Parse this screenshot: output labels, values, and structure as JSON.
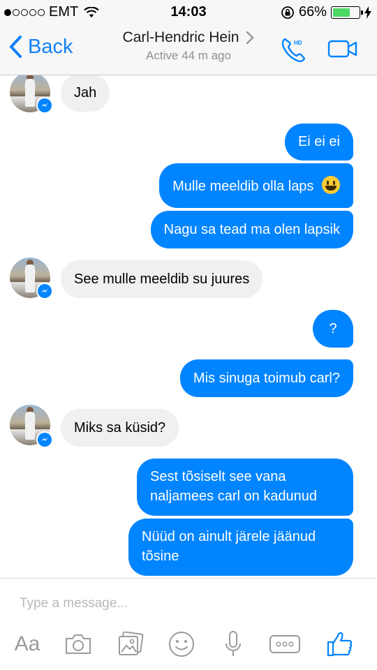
{
  "status_bar": {
    "carrier": "EMT",
    "time": "14:03",
    "battery_text": "66%",
    "battery_level": 0.66,
    "signal_bars_filled": 1,
    "signal_bars_total": 5
  },
  "nav": {
    "back_label": "Back",
    "contact_name": "Carl-Hendric Hein",
    "contact_status": "Active 44 m ago",
    "call_badge": "HD"
  },
  "messages": [
    {
      "direction": "in",
      "text": "Jah",
      "avatar": true
    },
    {
      "direction": "out",
      "text": "Ei ei ei"
    },
    {
      "direction": "out",
      "text": "Mulle meeldib olla laps",
      "emoji": "😃"
    },
    {
      "direction": "out",
      "text": "Nagu sa tead ma olen lapsik"
    },
    {
      "direction": "in",
      "text": "See mulle meeldib su juures",
      "avatar": true
    },
    {
      "direction": "out",
      "text": "?"
    },
    {
      "direction": "out",
      "text": "Mis sinuga toimub carl?"
    },
    {
      "direction": "in",
      "text": "Miks sa küsid?",
      "avatar": true
    },
    {
      "direction": "out",
      "text": "Sest tõsiselt see vana naljamees carl on kadunud"
    },
    {
      "direction": "out",
      "text": "Nüüd on ainult järele jäänud tõsine"
    }
  ],
  "composer": {
    "placeholder": "Type a message...",
    "text_format_label": "Aa"
  },
  "colors": {
    "accent": "#0084ff",
    "incoming_bubble": "#f0f0f0",
    "nav_link": "#1281f7",
    "icon_gray": "#9a9aa0",
    "battery_green": "#4cd964"
  }
}
